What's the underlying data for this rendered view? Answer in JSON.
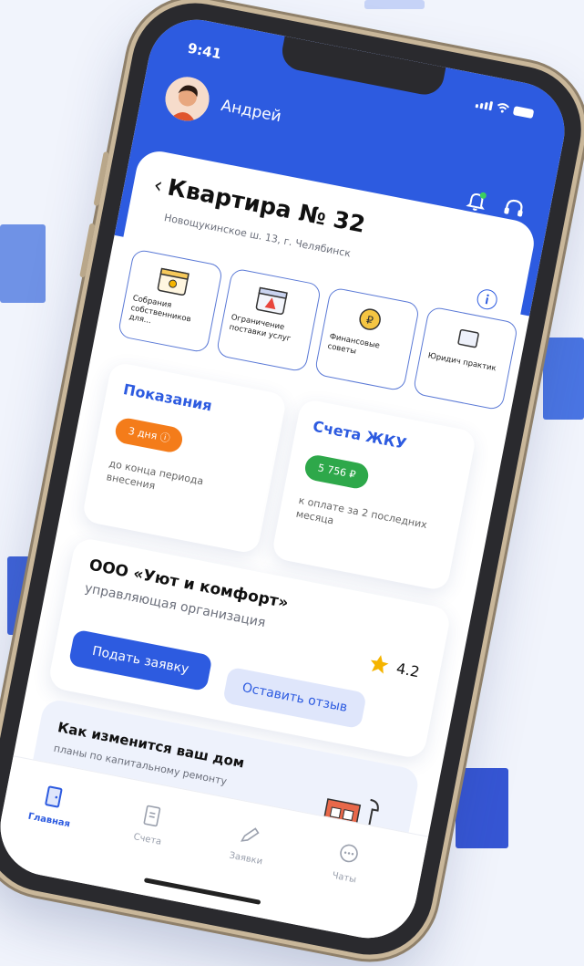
{
  "colors": {
    "accent": "#2d5be0",
    "orange": "#f47c1a",
    "green": "#2ea84a",
    "star": "#f5b400"
  },
  "status": {
    "time": "9:41"
  },
  "user": {
    "name": "Андрей"
  },
  "header": {
    "back_icon": "chevron-left-icon",
    "title": "Квартира № 32",
    "address": "Новощукинское ш. 13, г. Челябинск"
  },
  "tiles": [
    {
      "label": "Собрания собственников для...",
      "icon": "calendar-sun-icon"
    },
    {
      "label": "Ограничение поставки услуг",
      "icon": "calendar-warning-icon"
    },
    {
      "label": "Финансовые советы",
      "icon": "coin-icon"
    },
    {
      "label": "Юридич практик",
      "icon": "law-icon"
    }
  ],
  "readings": {
    "title": "Показания",
    "badge": "3 дня",
    "note": "до конца периода внесения"
  },
  "bills": {
    "title": "Счета ЖКУ",
    "amount": "5 756 ₽",
    "note": "к оплате за 2 последних месяца"
  },
  "org": {
    "name": "ООО «Уют и комфорт»",
    "subtitle": "управляющая организация",
    "rating": "4.2",
    "submit_label": "Подать заявку",
    "review_label": "Оставить отзыв"
  },
  "house": {
    "title": "Как изменится ваш дом",
    "subtitle": "планы по капитальному ремонту"
  },
  "nav": [
    {
      "label": "Главная",
      "icon": "door-icon",
      "active": true
    },
    {
      "label": "Счета",
      "icon": "receipt-icon",
      "active": false
    },
    {
      "label": "Заявки",
      "icon": "pencil-icon",
      "active": false
    },
    {
      "label": "Чаты",
      "icon": "chat-icon",
      "active": false
    }
  ]
}
